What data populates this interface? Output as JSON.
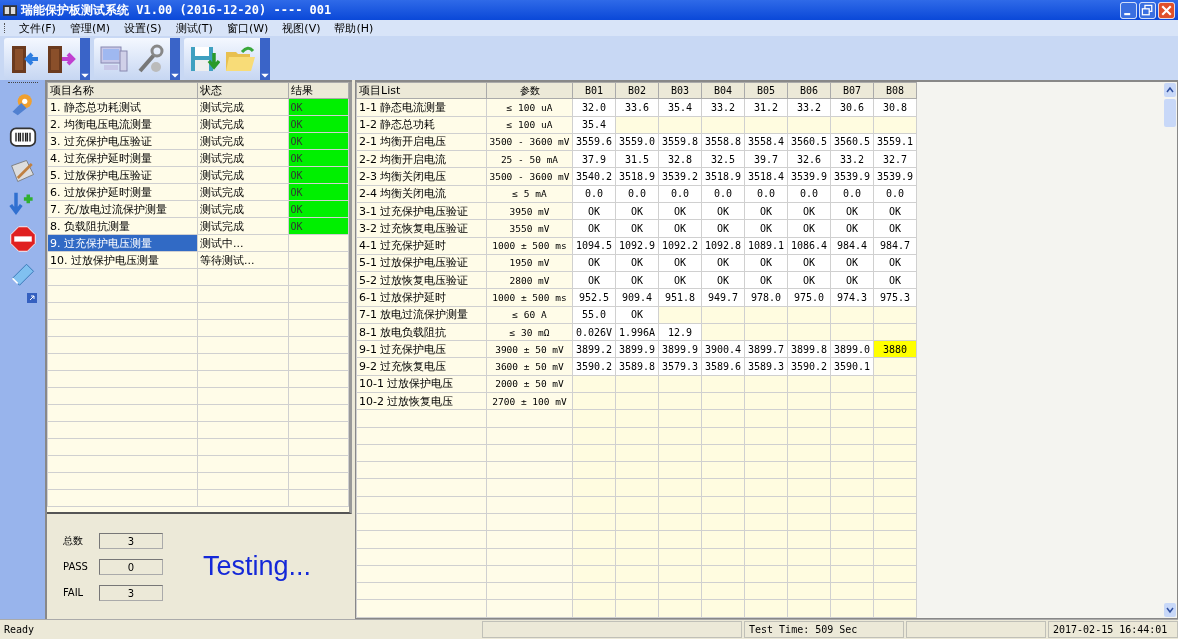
{
  "window": {
    "title": "瑞能保护板测试系统 V1.00 (2016-12-20) ---- 001"
  },
  "menu": [
    "文件(F)",
    "管理(M)",
    "设置(S)",
    "测试(T)",
    "窗口(W)",
    "视图(V)",
    "帮助(H)"
  ],
  "project_table": {
    "columns": [
      "项目名称",
      "状态",
      "结果"
    ],
    "rows": [
      {
        "name": "1.  静态总功耗测试",
        "status": "测试完成",
        "result": "OK",
        "passed": true,
        "selected": false
      },
      {
        "name": "2.  均衡电压电流测量",
        "status": "测试完成",
        "result": "OK",
        "passed": true,
        "selected": false
      },
      {
        "name": "3.  过充保护电压验证",
        "status": "测试完成",
        "result": "OK",
        "passed": true,
        "selected": false
      },
      {
        "name": "4.  过充保护延时测量",
        "status": "测试完成",
        "result": "OK",
        "passed": true,
        "selected": false
      },
      {
        "name": "5.  过放保护电压验证",
        "status": "测试完成",
        "result": "OK",
        "passed": true,
        "selected": false
      },
      {
        "name": "6.  过放保护延时测量",
        "status": "测试完成",
        "result": "OK",
        "passed": true,
        "selected": false
      },
      {
        "name": "7.  充/放电过流保护测量",
        "status": "测试完成",
        "result": "OK",
        "passed": true,
        "selected": false
      },
      {
        "name": "8.  负载阻抗测量",
        "status": "测试完成",
        "result": "OK",
        "passed": true,
        "selected": false
      },
      {
        "name": "9.  过充保护电压测量",
        "status": "测试中...",
        "passed": false,
        "selected": true
      },
      {
        "name": "10.  过放保护电压测量",
        "status": "等待测试...",
        "passed": false,
        "selected": false
      }
    ]
  },
  "stats": [
    {
      "label": "总数",
      "value": "3"
    },
    {
      "label": "PASS",
      "value": "0"
    },
    {
      "label": "FAIL",
      "value": "3"
    }
  ],
  "status_message": "Testing...",
  "result_grid": {
    "columns": [
      "项目List",
      "参数",
      "B01",
      "B02",
      "B03",
      "B04",
      "B05",
      "B06",
      "B07",
      "B08"
    ],
    "rows": [
      {
        "cells": [
          "1-1 静态电流测量",
          "≤ 100 uA",
          "32.0",
          "33.6",
          "35.4",
          "33.2",
          "31.2",
          "33.2",
          "30.6",
          "30.8"
        ]
      },
      {
        "cells": [
          "1-2 静态总功耗",
          "≤ 100 uA",
          "35.4",
          "",
          "",
          "",
          "",
          "",
          "",
          ""
        ]
      },
      {
        "cells": [
          "2-1 均衡开启电压",
          "3500 - 3600 mV",
          "3559.6",
          "3559.0",
          "3559.8",
          "3558.8",
          "3558.4",
          "3560.5",
          "3560.5",
          "3559.1"
        ]
      },
      {
        "cells": [
          "2-2 均衡开启电流",
          "25 - 50 mA",
          "37.9",
          "31.5",
          "32.8",
          "32.5",
          "39.7",
          "32.6",
          "33.2",
          "32.7"
        ]
      },
      {
        "cells": [
          "2-3 均衡关闭电压",
          "3500 - 3600 mV",
          "3540.2",
          "3518.9",
          "3539.2",
          "3518.9",
          "3518.4",
          "3539.9",
          "3539.9",
          "3539.9"
        ]
      },
      {
        "cells": [
          "2-4 均衡关闭电流",
          "≤ 5 mA",
          "0.0",
          "0.0",
          "0.0",
          "0.0",
          "0.0",
          "0.0",
          "0.0",
          "0.0"
        ]
      },
      {
        "cells": [
          "3-1 过充保护电压验证",
          "3950 mV",
          "OK",
          "OK",
          "OK",
          "OK",
          "OK",
          "OK",
          "OK",
          "OK"
        ]
      },
      {
        "cells": [
          "3-2 过充恢复电压验证",
          "3550 mV",
          "OK",
          "OK",
          "OK",
          "OK",
          "OK",
          "OK",
          "OK",
          "OK"
        ]
      },
      {
        "cells": [
          "4-1 过充保护延时",
          "1000 ± 500 ms",
          "1094.5",
          "1092.9",
          "1092.2",
          "1092.8",
          "1089.1",
          "1086.4",
          "984.4",
          "984.7"
        ]
      },
      {
        "cells": [
          "5-1 过放保护电压验证",
          "1950 mV",
          "OK",
          "OK",
          "OK",
          "OK",
          "OK",
          "OK",
          "OK",
          "OK"
        ]
      },
      {
        "cells": [
          "5-2 过放恢复电压验证",
          "2800 mV",
          "OK",
          "OK",
          "OK",
          "OK",
          "OK",
          "OK",
          "OK",
          "OK"
        ]
      },
      {
        "cells": [
          "6-1 过放保护延时",
          "1000 ± 500 ms",
          "952.5",
          "909.4",
          "951.8",
          "949.7",
          "978.0",
          "975.0",
          "974.3",
          "975.3"
        ]
      },
      {
        "cells": [
          "7-1 放电过流保护测量",
          "≤ 60 A",
          "55.0",
          "OK",
          "",
          "",
          "",
          "",
          "",
          ""
        ]
      },
      {
        "cells": [
          "8-1 放电负载阻抗",
          "≤ 30 mΩ",
          "0.026V",
          "1.996A",
          "12.9",
          "",
          "",
          "",
          "",
          ""
        ]
      },
      {
        "cells": [
          "9-1 过充保护电压",
          "3900 ± 50 mV",
          "3899.2",
          "3899.9",
          "3899.9",
          "3900.4",
          "3899.7",
          "3899.8",
          "3899.0",
          {
            "text": "3880",
            "flagged": true
          }
        ]
      },
      {
        "cells": [
          "9-2 过充恢复电压",
          "3600 ± 50 mV",
          "3590.2",
          "3589.8",
          "3579.3",
          "3589.6",
          "3589.3",
          "3590.2",
          "3590.1",
          ""
        ]
      },
      {
        "cells": [
          "10-1 过放保护电压",
          "2000 ± 50 mV",
          "",
          "",
          "",
          "",
          "",
          "",
          "",
          ""
        ]
      },
      {
        "cells": [
          "10-2 过放恢复电压",
          "2700 ± 100 mV",
          "",
          "",
          "",
          "",
          "",
          "",
          "",
          ""
        ]
      }
    ]
  },
  "status_bar": {
    "message": "Ready",
    "test_time": "Test Time: 509 Sec",
    "datetime": "2017-02-15 16:44:01"
  }
}
